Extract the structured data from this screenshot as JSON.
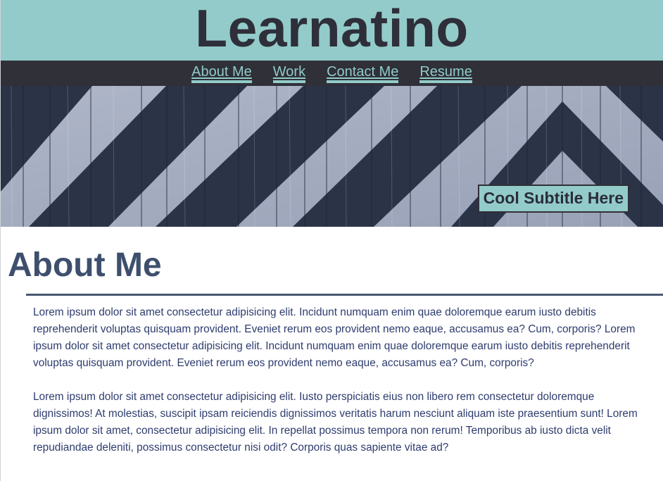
{
  "header": {
    "title": "Learnatino"
  },
  "nav": {
    "items": [
      {
        "label": "About Me"
      },
      {
        "label": "Work"
      },
      {
        "label": "Contact Me"
      },
      {
        "label": "Resume"
      }
    ]
  },
  "hero": {
    "subtitle": "Cool Subtitle Here"
  },
  "about": {
    "heading": "About Me",
    "paragraphs": [
      "Lorem ipsum dolor sit amet consectetur adipisicing elit. Incidunt numquam enim quae doloremque earum iusto debitis reprehenderit voluptas quisquam provident. Eveniet rerum eos provident nemo eaque, accusamus ea? Cum, corporis? Lorem ipsum dolor sit amet consectetur adipisicing elit. Incidunt numquam enim quae doloremque earum iusto debitis reprehenderit voluptas quisquam provident. Eveniet rerum eos provident nemo eaque, accusamus ea? Cum, corporis?",
      "Lorem ipsum dolor sit amet consectetur adipisicing elit. Iusto perspiciatis eius non libero rem consectetur doloremque dignissimos! At molestias, suscipit ipsam reiciendis dignissimos veritatis harum nesciunt aliquam iste praesentium sunt! Lorem ipsum dolor sit amet, consectetur adipisicing elit. In repellat possimus tempora non rerum! Temporibus ab iusto dicta velit repudiandae deleniti, possimus consectetur nisi odit? Corporis quas sapiente vitae ad?"
    ]
  },
  "colors": {
    "header_bg": "#93cbca",
    "nav_bg": "#2f3038",
    "heading": "#3e4f6e",
    "body_text": "#2e3c6e",
    "hero_light": "#a5aec2",
    "hero_dark": "#2b3347"
  }
}
